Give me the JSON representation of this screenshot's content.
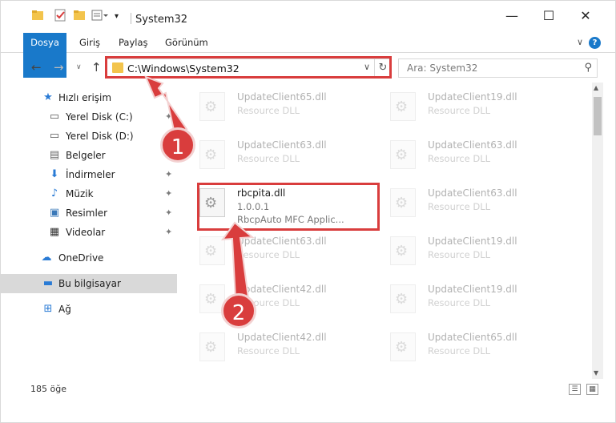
{
  "window": {
    "title": "System32",
    "minimize": "—",
    "maximize": "☐",
    "close": "✕"
  },
  "ribbon": {
    "tabs": [
      "Dosya",
      "Giriş",
      "Paylaş",
      "Görünüm"
    ]
  },
  "address": {
    "path": "C:\\Windows\\System32"
  },
  "search": {
    "placeholder": "Ara: System32"
  },
  "sidebar": {
    "items": [
      {
        "label": "Hızlı erişim",
        "icon": "star-icon",
        "pinned": false
      },
      {
        "label": "Yerel Disk (C:)",
        "icon": "drive-icon",
        "pinned": true
      },
      {
        "label": "Yerel Disk (D:)",
        "icon": "drive-icon",
        "pinned": true
      },
      {
        "label": "Belgeler",
        "icon": "document-icon",
        "pinned": true
      },
      {
        "label": "İndirmeler",
        "icon": "download-icon",
        "pinned": true
      },
      {
        "label": "Müzik",
        "icon": "music-icon",
        "pinned": true
      },
      {
        "label": "Resimler",
        "icon": "picture-icon",
        "pinned": true
      },
      {
        "label": "Videolar",
        "icon": "video-icon",
        "pinned": true
      },
      {
        "label": "OneDrive",
        "icon": "cloud-icon",
        "pinned": false
      },
      {
        "label": "Bu bilgisayar",
        "icon": "computer-icon",
        "pinned": false
      },
      {
        "label": "Ağ",
        "icon": "network-icon",
        "pinned": false
      }
    ]
  },
  "files": [
    {
      "name": "UpdateClient65.dll",
      "line1": "Resource DLL",
      "line2": ""
    },
    {
      "name": "UpdateClient19.dll",
      "line1": "Resource DLL",
      "line2": ""
    },
    {
      "name": "UpdateClient63.dll",
      "line1": "Resource DLL",
      "line2": ""
    },
    {
      "name": "UpdateClient63.dll",
      "line1": "Resource DLL",
      "line2": ""
    },
    {
      "name": "rbcpita.dll",
      "line1": "1.0.0.1",
      "line2": "RbcpAuto MFC Applic..."
    },
    {
      "name": "UpdateClient63.dll",
      "line1": "Resource DLL",
      "line2": ""
    },
    {
      "name": "UpdateClient63.dll",
      "line1": "Resource DLL",
      "line2": ""
    },
    {
      "name": "UpdateClient19.dll",
      "line1": "Resource DLL",
      "line2": ""
    },
    {
      "name": "UpdateClient42.dll",
      "line1": "Resource DLL",
      "line2": ""
    },
    {
      "name": "UpdateClient19.dll",
      "line1": "Resource DLL",
      "line2": ""
    },
    {
      "name": "UpdateClient42.dll",
      "line1": "Resource DLL",
      "line2": ""
    },
    {
      "name": "UpdateClient65.dll",
      "line1": "Resource DLL",
      "line2": ""
    }
  ],
  "status": {
    "count": "185 öğe"
  },
  "annotations": {
    "step1": "1",
    "step2": "2"
  },
  "colors": {
    "accent": "#1979ca",
    "highlight": "#d93d3d"
  }
}
